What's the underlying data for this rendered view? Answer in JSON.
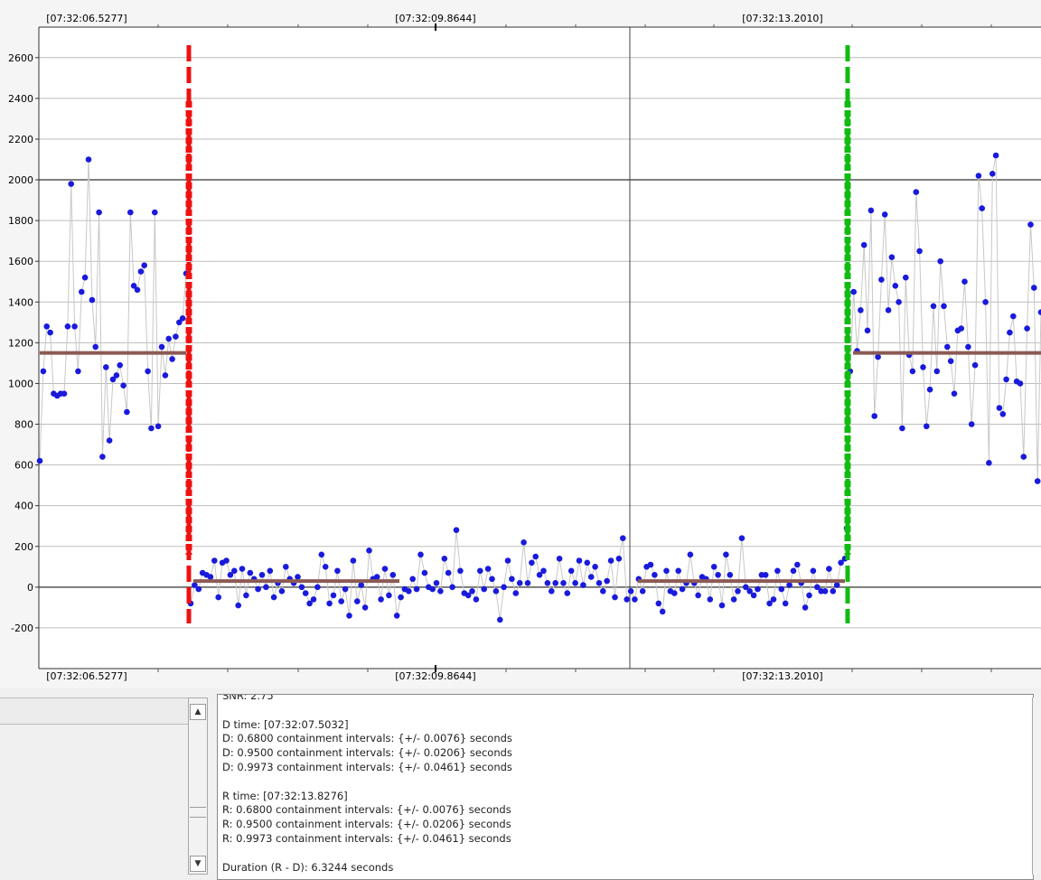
{
  "chart": {
    "top_time_labels": [
      "[07:32:06.5277]",
      "[07:32:09.8644]",
      "[07:32:13.2010]"
    ],
    "bottom_time_labels": [
      "[07:32:06.5277]",
      "[07:32:09.8644]",
      "[07:32:13.2010]"
    ],
    "colors": {
      "points": "#1a1adc",
      "connector": "#c8c8c8",
      "mean_line": "#8b5a55",
      "d_marker": "#ee1111",
      "r_marker": "#11bb11",
      "grid": "#bdbdbd",
      "major_grid": "#555555"
    }
  },
  "chart_data": {
    "type": "scatter",
    "ylim": [
      -400,
      2750
    ],
    "yticks": [
      -200,
      0,
      200,
      400,
      600,
      800,
      1000,
      1200,
      1400,
      1600,
      1800,
      2000,
      2200,
      2400,
      2600
    ],
    "xlim": [
      6.45,
      13.9
    ],
    "x_tick_labels": [
      "[07:32:06.5277]",
      "[07:32:09.8644]",
      "[07:32:13.2010]"
    ],
    "x_ticks": [
      6.5277,
      9.8644,
      13.201
    ],
    "d_time": 7.5032,
    "r_time": 13.8276,
    "mean_levels": [
      {
        "x": [
          6.45,
          7.48
        ],
        "y": 1150
      },
      {
        "x": [
          7.55,
          9.0
        ],
        "y": 30
      },
      {
        "x": [
          10.75,
          13.8
        ],
        "y": 30
      },
      {
        "x": [
          13.85,
          13.9
        ],
        "y": 1150
      }
    ],
    "segment_before_d": {
      "x_start": 6.45,
      "x_end": 7.47,
      "y": [
        620,
        1060,
        1280,
        1250,
        950,
        940,
        950,
        950,
        1280,
        1980,
        1280,
        1060,
        1450,
        1520,
        2100,
        1410,
        1180,
        1840,
        640,
        1080,
        720,
        1020,
        1040,
        1090,
        990,
        860,
        1840,
        1480,
        1460,
        1550,
        1580,
        1060,
        780,
        1840,
        790,
        1180,
        1040,
        1220,
        1120,
        1230,
        1300,
        1320,
        1540
      ]
    },
    "segment_after_d": {
      "x_start": 7.49,
      "x_end": 13.82,
      "y": [
        -80,
        10,
        -10,
        70,
        60,
        50,
        130,
        -50,
        120,
        130,
        60,
        80,
        -90,
        90,
        -40,
        70,
        40,
        -10,
        60,
        0,
        80,
        -50,
        20,
        -20,
        100,
        40,
        20,
        50,
        0,
        -30,
        -80,
        -60,
        0,
        160,
        100,
        -80,
        -40,
        80,
        -70,
        -10,
        -140,
        130,
        -70,
        10,
        -100,
        180,
        40,
        50,
        -60,
        90,
        -40,
        60,
        -140,
        -50,
        -10,
        -20,
        40,
        -10,
        160,
        70,
        0,
        -10,
        20,
        -20,
        140,
        70,
        0,
        280,
        80,
        -30,
        -40,
        -20,
        -60,
        80,
        -10,
        90,
        40,
        -20,
        -160,
        0,
        130,
        40,
        -30,
        20,
        220,
        20,
        120,
        150,
        60,
        80,
        20,
        -20,
        20,
        140,
        20,
        -30,
        80,
        20,
        130,
        10,
        120,
        50,
        100,
        20,
        -20,
        30,
        130,
        -50,
        140,
        240,
        -60,
        -20,
        -60,
        40,
        -20,
        100,
        110,
        60,
        -80,
        -120,
        80,
        -20,
        -30,
        80,
        -10,
        20,
        160,
        20,
        -40,
        50,
        40,
        -60,
        100,
        60,
        -90,
        160,
        60,
        -60,
        -20,
        240,
        0,
        -20,
        -40,
        -10,
        60,
        60,
        -80,
        -60,
        80,
        -10,
        -80,
        10,
        80,
        110,
        20,
        -100,
        -40,
        80,
        0,
        -20,
        -20,
        90,
        -20,
        10,
        120,
        140
      ]
    },
    "segment_after_r": {
      "x_start": 13.83,
      "x_end": 13.9,
      "y": [
        290,
        1060,
        1450,
        1160,
        1360,
        1680,
        1260,
        1850,
        840,
        1130,
        1510,
        1830,
        1360,
        1620,
        1480,
        1400,
        780,
        1520,
        1140,
        1060,
        1940,
        1650,
        1080,
        790,
        970,
        1380,
        1060,
        1600,
        1380,
        1180,
        1110,
        950,
        1260,
        1270,
        1500,
        1180,
        800,
        1090,
        2020,
        1860,
        1400,
        610,
        2030,
        2120,
        880,
        850,
        1020,
        1250,
        1330,
        1010,
        1000,
        640,
        1270,
        1780,
        1470,
        520,
        1350
      ]
    }
  },
  "log": {
    "lines": [
      "SNR: 2.75",
      "",
      "D time: [07:32:07.5032]",
      "D: 0.6800 containment intervals: {+/- 0.0076} seconds",
      "D: 0.9500 containment intervals: {+/- 0.0206} seconds",
      "D: 0.9973 containment intervals: {+/- 0.0461} seconds",
      "",
      "R time: [07:32:13.8276]",
      "R: 0.6800 containment intervals: {+/- 0.0076} seconds",
      "R: 0.9500 containment intervals: {+/- 0.0206} seconds",
      "R: 0.9973 containment intervals: {+/- 0.0461} seconds",
      "",
      "Duration (R - D): 6.3244 seconds"
    ]
  },
  "icons": {
    "scroll_up": "arrow-up-icon",
    "scroll_down": "arrow-down-icon"
  }
}
